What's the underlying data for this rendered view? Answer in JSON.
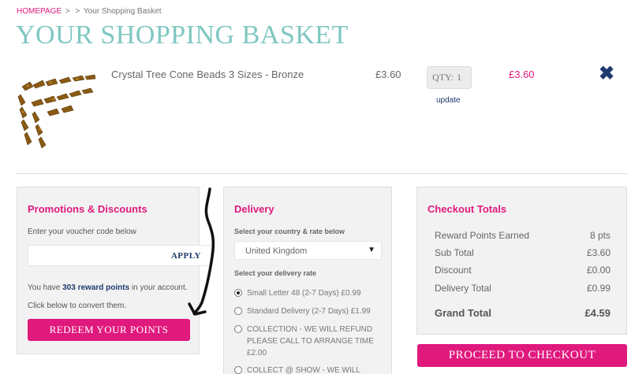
{
  "breadcrumb": {
    "home": "HOMEPAGE",
    "sep1": ">",
    "sep2": ">",
    "current": "Your Shopping Basket"
  },
  "page_title": "YOUR SHOPPING BASKET",
  "basket": {
    "item": {
      "name": "Crystal Tree Cone Beads 3 Sizes - Bronze",
      "unit_price": "£3.60",
      "qty_label": "QTY:",
      "qty_value": "1",
      "update_label": "update",
      "line_total": "£3.60",
      "remove_icon": "close-icon"
    }
  },
  "promotions": {
    "title": "Promotions & Discounts",
    "voucher_label": "Enter your voucher code below",
    "voucher_value": "",
    "apply_label": "APPLY",
    "points_prefix": "You have",
    "points_value": "303 reward points",
    "points_suffix": "in your account.",
    "convert_text": "Click below to convert them.",
    "redeem_label": "REDEEM YOUR POINTS"
  },
  "delivery": {
    "title": "Delivery",
    "country_label": "Select your country & rate below",
    "country_value": "United Kingdom",
    "rate_label": "Select your delivery rate",
    "options": [
      {
        "label": "Small Letter 48 (2-7 Days) £0.99",
        "checked": true
      },
      {
        "label": "Standard Delivery (2-7 Days) £1.99",
        "checked": false
      },
      {
        "label": "COLLECTION - WE WILL REFUND PLEASE CALL TO ARRANGE TIME £2.00",
        "checked": false
      },
      {
        "label": "COLLECT @ SHOW - WE WILL",
        "checked": false
      }
    ]
  },
  "totals": {
    "title": "Checkout Totals",
    "rows": [
      {
        "label": "Reward Points Earned",
        "value": "8 pts"
      },
      {
        "label": "Sub Total",
        "value": "£3.60"
      },
      {
        "label": "Discount",
        "value": "£0.00"
      },
      {
        "label": "Delivery Total",
        "value": "£0.99"
      }
    ],
    "grand_label": "Grand Total",
    "grand_value": "£4.59",
    "checkout_label": "PROCEED TO CHECKOUT"
  },
  "colors": {
    "accent": "#e0197d",
    "title_teal": "#7fc7c1",
    "navy": "#1e3a6e"
  }
}
